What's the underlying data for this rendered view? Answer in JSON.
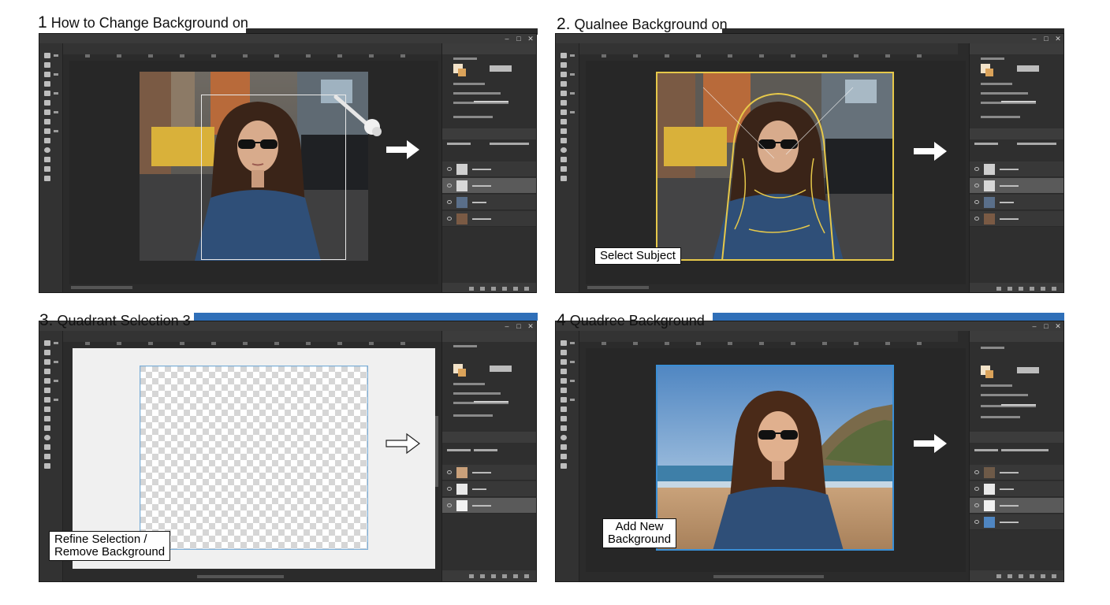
{
  "panels": [
    {
      "num": "1",
      "title": "How to Change Background on"
    },
    {
      "num": "2.",
      "title": "Qualnee Background on"
    },
    {
      "num": "3.",
      "title": "Quadrant Selection 3"
    },
    {
      "num": "4",
      "title": "Quadree Background"
    }
  ],
  "callouts": {
    "panel2": "Select Subject",
    "panel3_line1": "Refine Selection /",
    "panel3_line2": "Remove Background",
    "panel4_line1": "Add New",
    "panel4_line2": "Background"
  },
  "window_controls": [
    "–",
    "□",
    "✕"
  ],
  "colors": {
    "ui_dark": "#2b2b2b",
    "panel_dark": "#2f2f2f",
    "active_layer": "#5a5a5a",
    "selection_outline": "#e6c84a",
    "title_strip_blue": "#2f6fb8",
    "new_bg_frame": "#3a8fd6"
  },
  "icons": [
    "arrow-right-icon",
    "wand-icon",
    "eye-icon",
    "minimize-icon",
    "maximize-icon",
    "close-icon"
  ]
}
